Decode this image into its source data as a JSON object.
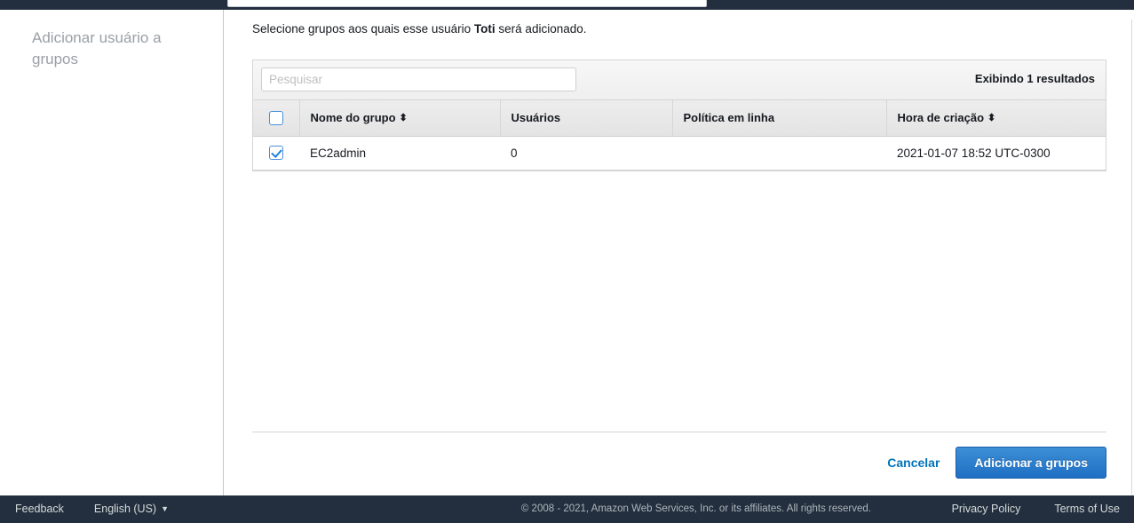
{
  "window": {
    "top_strip_color": "#232f3e"
  },
  "sidebar": {
    "title": "Adicionar usuário a grupos"
  },
  "main": {
    "intro_prefix": "Selecione grupos aos quais esse usuário ",
    "intro_user": "Toti",
    "intro_suffix": " será adicionado."
  },
  "search": {
    "placeholder": "Pesquisar",
    "value": ""
  },
  "results": {
    "count_label": "Exibindo 1 resultados"
  },
  "table": {
    "columns": [
      {
        "key": "select",
        "label": "",
        "sortable": false
      },
      {
        "key": "name",
        "label": "Nome do grupo",
        "sortable": true,
        "sort_icon": "sort-arrows-icon"
      },
      {
        "key": "users",
        "label": "Usuários",
        "sortable": false
      },
      {
        "key": "policy",
        "label": "Política em linha",
        "sortable": false
      },
      {
        "key": "created",
        "label": "Hora de criação",
        "sortable": true,
        "sort_icon": "sort-arrows-icon"
      }
    ],
    "sort_glyph": "⬍",
    "header_select_all_checked": false,
    "rows": [
      {
        "selected": true,
        "name": "EC2admin",
        "users": "0",
        "policy": "",
        "created": "2021-01-07 18:52 UTC-0300"
      }
    ]
  },
  "actions": {
    "cancel_label": "Cancelar",
    "submit_label": "Adicionar a grupos",
    "primary_color": "#2a7fd0",
    "link_color": "#0073bb"
  },
  "footer": {
    "feedback_label": "Feedback",
    "language_label": "English (US)",
    "language_caret": "▼",
    "copyright": "© 2008 - 2021, Amazon Web Services, Inc. or its affiliates. All rights reserved.",
    "privacy_label": "Privacy Policy",
    "terms_label": "Terms of Use"
  }
}
